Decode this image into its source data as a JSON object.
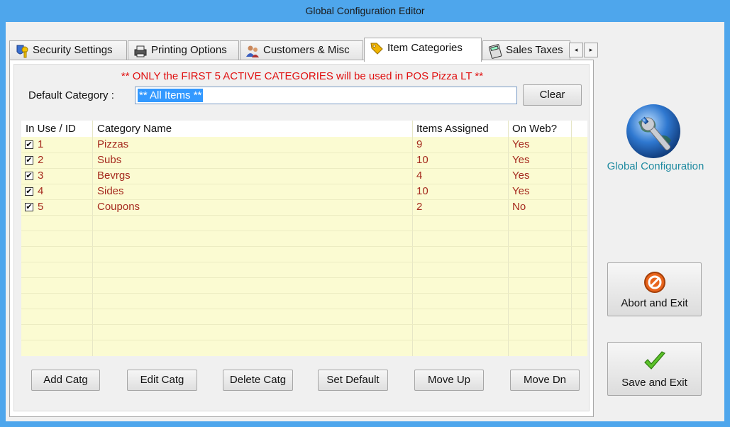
{
  "window": {
    "title": "Global Configuration Editor"
  },
  "tabs": [
    {
      "label": "Security Settings",
      "icon": "key-shield-icon"
    },
    {
      "label": "Printing Options",
      "icon": "printer-icon"
    },
    {
      "label": "Customers & Misc",
      "icon": "users-icon"
    },
    {
      "label": "Item Categories",
      "icon": "tag-icon",
      "active": true
    },
    {
      "label": "Sales Taxes",
      "icon": "calculator-icon"
    }
  ],
  "tab_scroll": {
    "left": "◂",
    "right": "▸"
  },
  "panel": {
    "notice": "** ONLY the FIRST 5 ACTIVE CATEGORIES will be used in POS Pizza LT **",
    "default_label": "Default Category :",
    "default_value": "** All Items **",
    "clear_label": "Clear"
  },
  "table": {
    "columns": [
      "In Use / ID",
      "Category Name",
      "Items Assigned",
      "On Web?"
    ],
    "rows": [
      {
        "checked": true,
        "id": "1",
        "name": "Pizzas",
        "items": "9",
        "web": "Yes"
      },
      {
        "checked": true,
        "id": "2",
        "name": "Subs",
        "items": "10",
        "web": "Yes"
      },
      {
        "checked": true,
        "id": "3",
        "name": "Bevrgs",
        "items": "4",
        "web": "Yes"
      },
      {
        "checked": true,
        "id": "4",
        "name": "Sides",
        "items": "10",
        "web": "Yes"
      },
      {
        "checked": true,
        "id": "5",
        "name": "Coupons",
        "items": "2",
        "web": "No"
      }
    ]
  },
  "buttons": {
    "add": "Add Catg",
    "edit": "Edit Catg",
    "delete": "Delete Catg",
    "set_default": "Set Default",
    "move_up": "Move Up",
    "move_dn": "Move Dn"
  },
  "side": {
    "title": "Global Configuration",
    "abort": "Abort and Exit",
    "save": "Save and Exit"
  },
  "colors": {
    "window_frame": "#4ea6ec",
    "grid_bg": "#fbfbd2",
    "row_text": "#a52a1e",
    "notice_text": "#e01010",
    "selection": "#3399ff",
    "side_title": "#1f8aa0"
  }
}
